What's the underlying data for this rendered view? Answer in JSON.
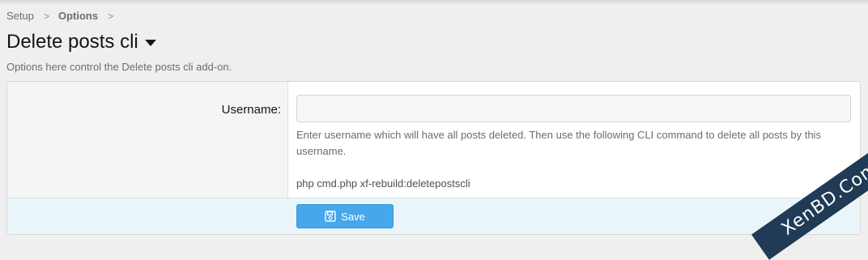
{
  "breadcrumb": {
    "items": [
      {
        "label": "Setup"
      },
      {
        "label": "Options"
      }
    ],
    "separator": ">"
  },
  "page": {
    "title": "Delete posts cli",
    "description": "Options here control the Delete posts cli add-on."
  },
  "form": {
    "username_label": "Username:",
    "username_value": "",
    "username_placeholder": "",
    "explain_text": "Enter username which will have all posts deleted. Then use the following CLI command to delete all posts by this username.",
    "cli_command": "php cmd.php xf-rebuild:deletepostscli"
  },
  "footer": {
    "save_label": "Save"
  },
  "watermark": {
    "text": "XenBD.Com"
  },
  "colors": {
    "page_bg": "#efefef",
    "button": "#47a7eb",
    "footer_bg": "#eaf5f9",
    "watermark_bg": "#1f3b55"
  },
  "icons": {
    "title_dropdown": "caret-down-icon",
    "save": "floppy-disk-icon"
  }
}
